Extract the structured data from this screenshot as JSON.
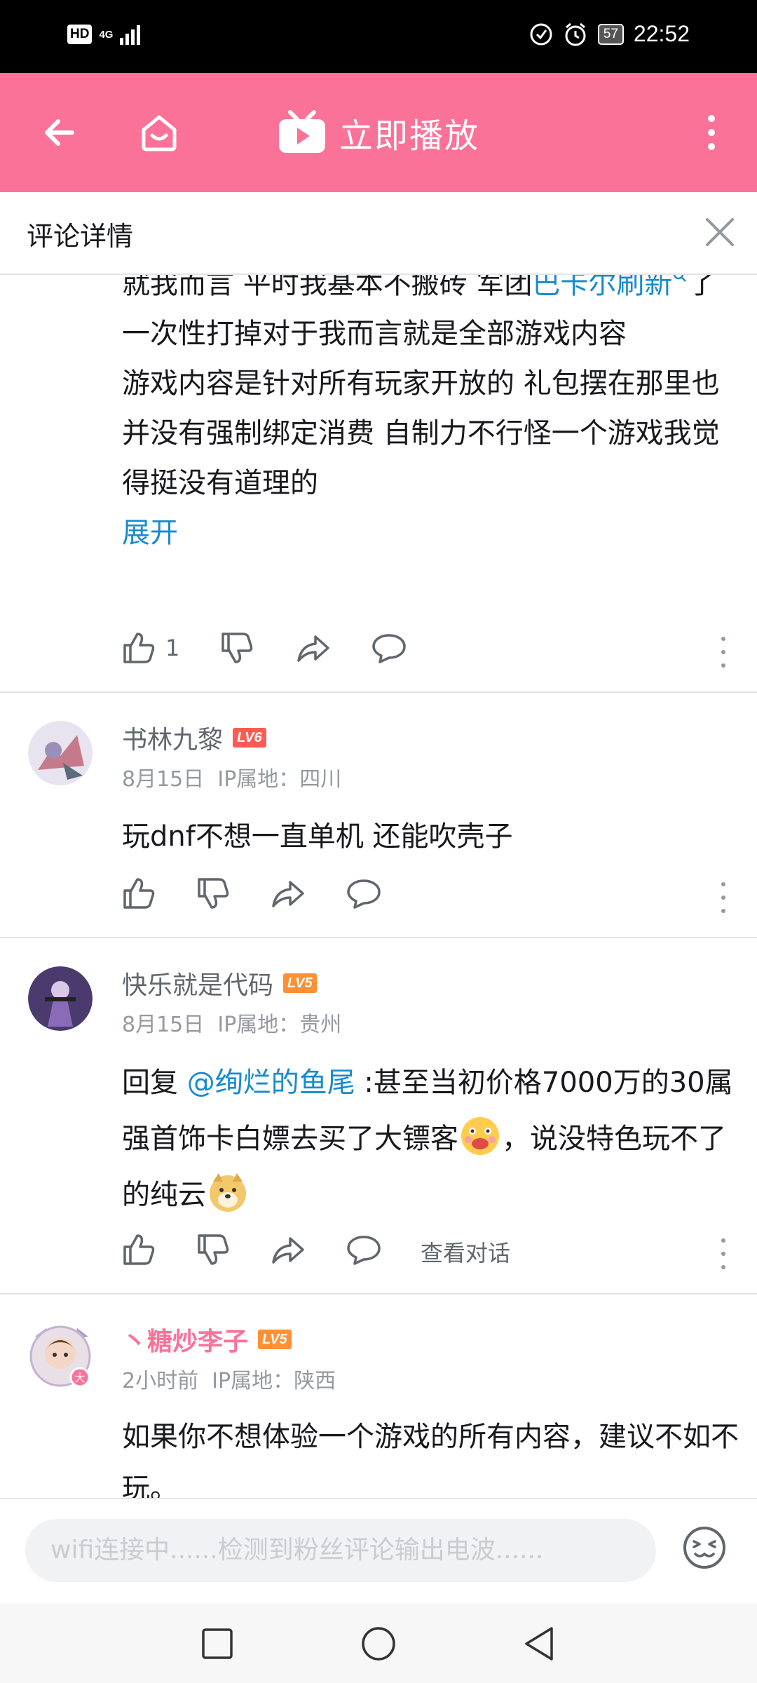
{
  "status_bar": {
    "hd": "HD",
    "network": "4G",
    "battery": "57",
    "time": "22:52"
  },
  "header": {
    "play_label": "立即播放"
  },
  "sub_header": {
    "title": "评论详情"
  },
  "comment0": {
    "line1": "就我而言  平时我基本不搬砖 军团",
    "link": "巴卡尔刷新",
    "line2_rest": "了一次性打掉对于我而言就是全部游戏内容",
    "para2": "游戏内容是针对所有玩家开放的 礼包摆在那里也并没有强制绑定消费 自制力不行怪一个游戏我觉得挺没有道理的",
    "expand": "展开",
    "likes": "1"
  },
  "comment1": {
    "username": "书林九黎",
    "level": "LV6",
    "date": "8月15日",
    "location": "IP属地：四川",
    "text": "玩dnf不想一直单机 还能吹壳子"
  },
  "comment2": {
    "username": "快乐就是代码",
    "level": "LV5",
    "date": "8月15日",
    "location": "IP属地：贵州",
    "reply_prefix": "回复 ",
    "mention": "@绚烂的鱼尾",
    "text_a": " :甚至当初价格7000万的30属强首饰卡白嫖去买了大镖客",
    "text_b": "，说没特色玩不了的纯云",
    "view_conversation": "查看对话"
  },
  "comment3": {
    "username": "丶糖炒李子",
    "level": "LV5",
    "date": "2小时前",
    "location": "IP属地：陕西",
    "text": "如果你不想体验一个游戏的所有内容，建议不如不玩。"
  },
  "input_bar": {
    "placeholder": "wifi连接中......检测到粉丝评论输出电波......"
  },
  "colors": {
    "brand_pink": "#fb7299",
    "link_blue": "#178bcf",
    "lv6": "#ff5b53",
    "lv5": "#ff9033"
  }
}
